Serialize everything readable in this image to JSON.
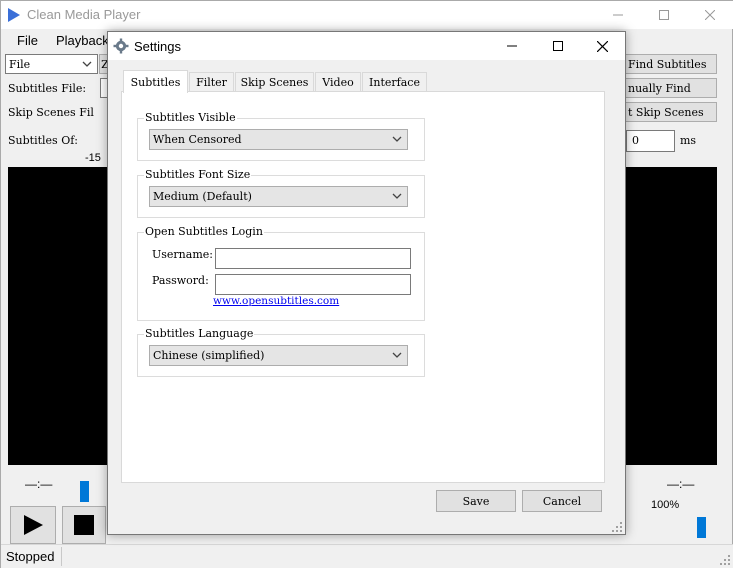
{
  "main_window": {
    "title": "Clean Media Player",
    "menu": [
      "File",
      "Playback"
    ],
    "file_combo": "File",
    "zoom_fragment": "Z",
    "labels": {
      "subtitles_file": "Subtitles File:",
      "skip_scenes_file": "Skip Scenes Fil",
      "subtitles_offset": "Subtitles Of:",
      "offset_min": "-15"
    },
    "right_buttons": {
      "find_subtitles": "Find Subtitles",
      "manually_find": "nually Find",
      "skip_scenes": "t Skip Scenes"
    },
    "offset_value": "0",
    "offset_unit": "ms",
    "time_left": "—:—",
    "time_right": "—:—",
    "volume": "100%",
    "status": "Stopped"
  },
  "dialog": {
    "title": "Settings",
    "tabs": [
      "Subtitles",
      "Filter",
      "Skip Scenes",
      "Video",
      "Interface"
    ],
    "active_tab": "Subtitles",
    "subtitles_visible": {
      "label": "Subtitles Visible",
      "value": "When Censored"
    },
    "font_size": {
      "label": "Subtitles Font Size",
      "value": "Medium (Default)"
    },
    "login": {
      "label": "Open Subtitles Login",
      "username_label": "Username:",
      "username_value": "",
      "password_label": "Password:",
      "password_value": "",
      "link": "www.opensubtitles.com"
    },
    "language": {
      "label": "Subtitles Language",
      "value": "Chinese (simplified)"
    },
    "save_label": "Save",
    "cancel_label": "Cancel"
  },
  "colors": {
    "accent": "#0078d7",
    "video_bg": "#000000",
    "link": "#0000ee"
  }
}
